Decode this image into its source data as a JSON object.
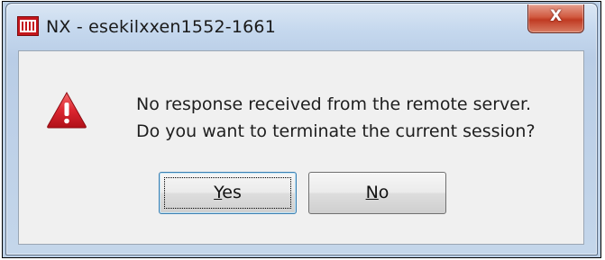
{
  "window": {
    "title": "NX - esekilxxen1552-1661",
    "close_glyph": "X"
  },
  "dialog": {
    "icon": "warning-icon",
    "message_line1": "No response received from the remote server.",
    "message_line2": "Do you want to terminate the current session?"
  },
  "buttons": {
    "yes_mnemonic": "Y",
    "yes_rest": "es",
    "no_mnemonic": "N",
    "no_rest": "o"
  },
  "colors": {
    "warning_red": "#d4202a",
    "app_icon_red": "#c4161c",
    "close_button_red": "#c03a22"
  }
}
